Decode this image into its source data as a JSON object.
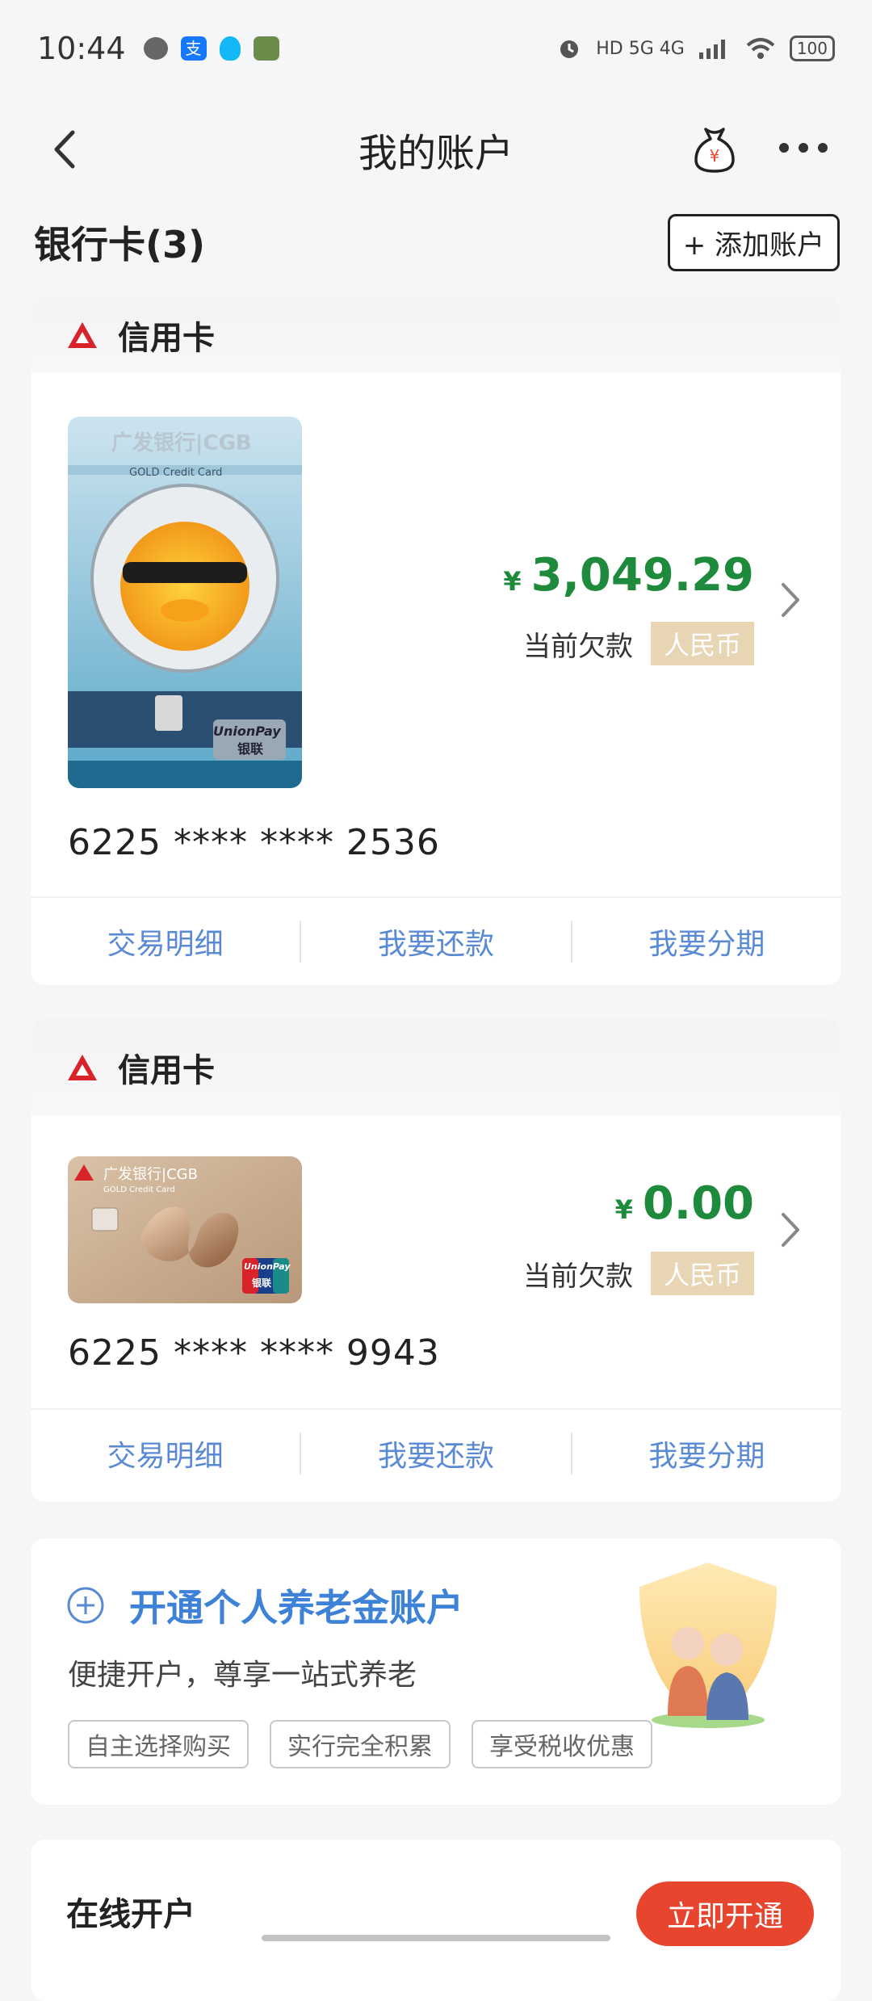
{
  "status_bar": {
    "time": "10:44",
    "alipay_glyph": "支",
    "indicators": "HD 5G 4G",
    "battery": "100"
  },
  "nav": {
    "title": "我的账户",
    "moneybag_glyph": "¥"
  },
  "accounts_section": {
    "title": "银行卡(3)",
    "add_button": "+ 添加账户"
  },
  "cards": [
    {
      "type_label": "信用卡",
      "currency_symbol": "¥",
      "amount": "3,049.29",
      "owed_label": "当前欠款",
      "currency": "人民币",
      "card_number": "6225 **** **** 2536",
      "card_brand_text": "广发银行|CGB",
      "card_subtitle": "GOLD Credit Card",
      "unionpay_label": "UnionPay",
      "unionpay_cn": "银联",
      "actions": [
        "交易明细",
        "我要还款",
        "我要分期"
      ]
    },
    {
      "type_label": "信用卡",
      "currency_symbol": "¥",
      "amount": "0.00",
      "owed_label": "当前欠款",
      "currency": "人民币",
      "card_number": "6225 **** **** 9943",
      "card_brand_text": "广发银行|CGB",
      "card_subtitle": "GOLD Credit Card",
      "unionpay_label": "UnionPay",
      "unionpay_cn": "银联",
      "actions": [
        "交易明细",
        "我要还款",
        "我要分期"
      ]
    }
  ],
  "pension": {
    "title": "开通个人养老金账户",
    "subtitle": "便捷开户，尊享一站式养老",
    "tags": [
      "自主选择购买",
      "实行完全积累",
      "享受税收优惠"
    ]
  },
  "online": {
    "title": "在线开户",
    "button": "立即开通"
  },
  "colors": {
    "accent_green": "#1e8a3c",
    "link_blue": "#5a8ad4",
    "pension_blue": "#3e82d8",
    "cta_red": "#e8452f",
    "badge_gold": "#e7d5b4"
  }
}
